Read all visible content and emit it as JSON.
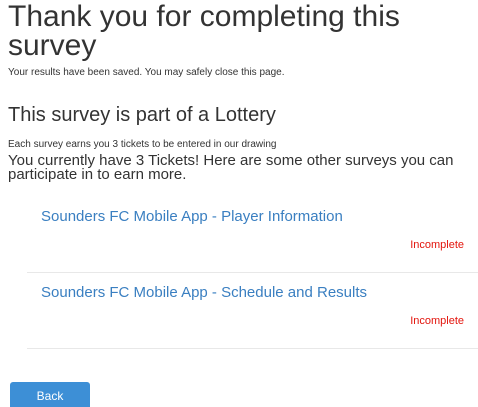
{
  "completion": {
    "title": "Thank you for completing this survey",
    "saved_note": "Your results have been saved. You may safely close this page."
  },
  "lottery": {
    "heading": "This survey is part of a Lottery",
    "tickets_note": "Each survey earns you 3 tickets to be entered in our drawing",
    "tickets_count": "You currently have 3 Tickets! Here are some other surveys you can participate in to earn more."
  },
  "surveys": [
    {
      "title": "Sounders FC Mobile App - Player Information",
      "status": "Incomplete"
    },
    {
      "title": "Sounders FC Mobile App - Schedule and Results",
      "status": "Incomplete"
    }
  ],
  "actions": {
    "back_label": "Back"
  },
  "colors": {
    "link": "#3a7fc1",
    "status_incomplete": "#e3140c",
    "button_bg": "#3d8fd6",
    "text": "#333333"
  }
}
